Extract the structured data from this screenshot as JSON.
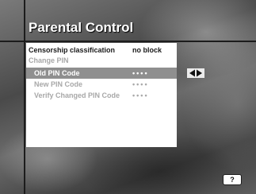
{
  "header": {
    "title": "Parental Control"
  },
  "menu": {
    "items": [
      {
        "label": "Censorship classification",
        "value": "no block"
      },
      {
        "label": "Change PIN",
        "value": ""
      },
      {
        "label": "Old PIN Code",
        "value": "••••",
        "selected": true
      },
      {
        "label": "New PIN Code",
        "value": "••••"
      },
      {
        "label": "Verify Changed PIN Code",
        "value": "••••"
      }
    ]
  },
  "controls": {
    "nav_arrows_icon": "left-right-arrows-icon",
    "help_label": "?"
  },
  "colors": {
    "panel_bg": "#ffffff",
    "selected_bg": "#8f8f8f",
    "active_text": "#1a1a1a",
    "inactive_text": "#a8a8a8",
    "title_text": "#ffffff"
  }
}
